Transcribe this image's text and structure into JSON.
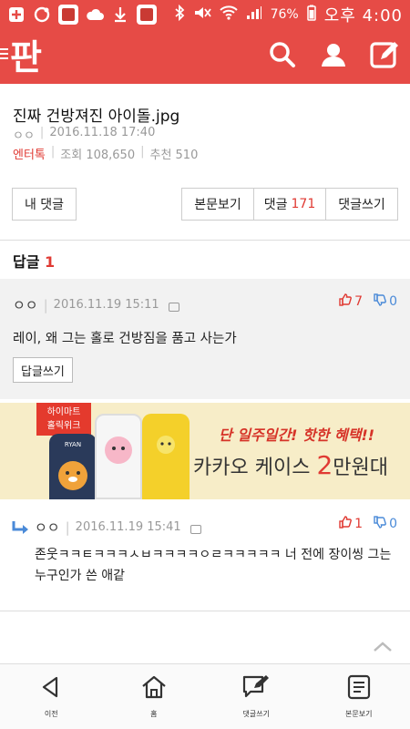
{
  "status_bar": {
    "battery": "76%",
    "time": "오후 4:00"
  },
  "header": {
    "logo_text": "판"
  },
  "article": {
    "title": "진짜 건방져진 아이돌.jpg",
    "author": "ㅇㅇ",
    "date": "2016.11.18 17:40",
    "category": "엔터톡",
    "views": "조회 108,650",
    "recommends": "추천 510"
  },
  "actions": {
    "my_comments": "내 댓글",
    "view_body": "본문보기",
    "comments_label": "댓글",
    "comments_count": "171",
    "write_comment": "댓글쓰기"
  },
  "replies_section": {
    "label": "답글",
    "count": "1"
  },
  "comment_1": {
    "author": "ㅇㅇ",
    "date": "2016.11.19 15:11",
    "upvotes": "7",
    "downvotes": "0",
    "text": "레이, 왜 그는 홀로 건방짐을 품고 사는가",
    "reply_button": "답글쓰기"
  },
  "ad": {
    "tag_line1": "하이마트",
    "tag_line2": "홀릭위크",
    "phone_label": "RYAN",
    "line1": "단 일주일간! 핫한 혜택!!",
    "line2_prefix": "카카오 케이스 ",
    "line2_big": "2",
    "line2_suffix": "만원대"
  },
  "comment_2": {
    "author": "ㅇㅇ",
    "date": "2016.11.19 15:41",
    "upvotes": "1",
    "downvotes": "0",
    "text": "존웃ㅋㅋㅌㅋㅋㅋㅅㅂㅋㅋㅋㅋㅇㄹㅋㅋㅋㅋㅋ 너 전에 장이씽 그는 누구인가 쓴 애같"
  },
  "bottom_nav": {
    "back": "이전",
    "home": "홈",
    "write": "댓글쓰기",
    "view": "본문보기"
  },
  "colors": {
    "brand": "#e64b46",
    "accent_red": "#e03a33",
    "down_blue": "#4a8ad8"
  }
}
